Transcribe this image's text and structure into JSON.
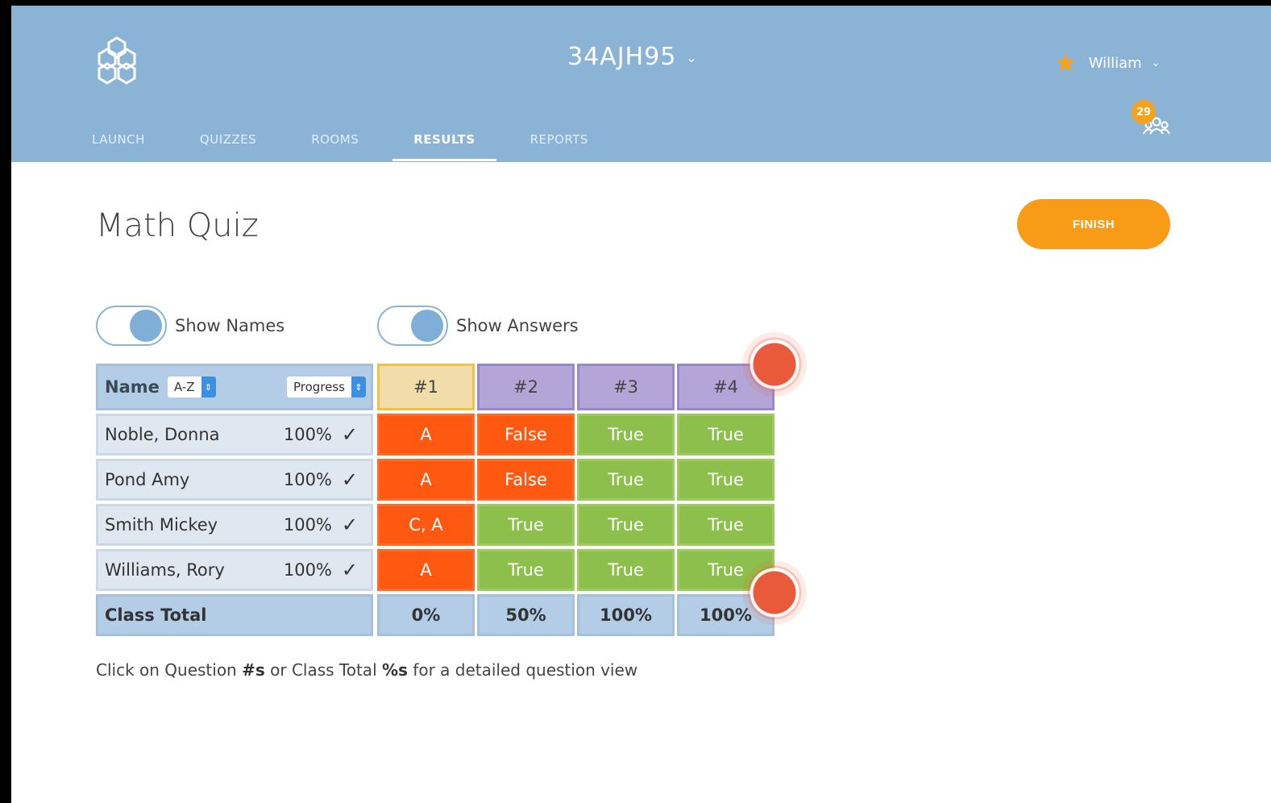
{
  "header": {
    "room_code": "34AJH95",
    "user_name": "William",
    "student_count": "29",
    "tabs": [
      {
        "label": "LAUNCH",
        "active": false
      },
      {
        "label": "QUIZZES",
        "active": false
      },
      {
        "label": "ROOMS",
        "active": false
      },
      {
        "label": "RESULTS",
        "active": true
      },
      {
        "label": "REPORTS",
        "active": false
      }
    ]
  },
  "page": {
    "title": "Math Quiz",
    "finish_label": "FINISH",
    "toggles": {
      "show_names": "Show Names",
      "show_answers": "Show Answers"
    }
  },
  "table": {
    "name_header": "Name",
    "sort_value": "A-Z",
    "progress_value": "Progress",
    "questions": [
      "#1",
      "#2",
      "#3",
      "#4"
    ],
    "rows": [
      {
        "name": "Noble, Donna",
        "progress": "100%",
        "answers": [
          {
            "text": "A",
            "correct": false
          },
          {
            "text": "False",
            "correct": false
          },
          {
            "text": "True",
            "correct": true
          },
          {
            "text": "True",
            "correct": true
          }
        ]
      },
      {
        "name": "Pond Amy",
        "progress": "100%",
        "answers": [
          {
            "text": "A",
            "correct": false
          },
          {
            "text": "False",
            "correct": false
          },
          {
            "text": "True",
            "correct": true
          },
          {
            "text": "True",
            "correct": true
          }
        ]
      },
      {
        "name": "Smith Mickey",
        "progress": "100%",
        "answers": [
          {
            "text": "C, A",
            "correct": false
          },
          {
            "text": "True",
            "correct": true
          },
          {
            "text": "True",
            "correct": true
          },
          {
            "text": "True",
            "correct": true
          }
        ]
      },
      {
        "name": "Williams, Rory",
        "progress": "100%",
        "answers": [
          {
            "text": "A",
            "correct": false
          },
          {
            "text": "True",
            "correct": true
          },
          {
            "text": "True",
            "correct": true
          },
          {
            "text": "True",
            "correct": true
          }
        ]
      }
    ],
    "class_total_label": "Class Total",
    "totals": [
      "0%",
      "50%",
      "100%",
      "100%"
    ]
  },
  "hint": {
    "before": "Click on Question ",
    "bold1": "#s",
    "middle": " or Class Total ",
    "bold2": "%s",
    "after": " for a detailed question view"
  },
  "colors": {
    "header_bg": "#8ab3d5",
    "accent_orange": "#f89b16",
    "incorrect": "#ff5811",
    "correct": "#8cbf4c",
    "q1_header": "#f2dcaa",
    "q_header": "#b3a6d6"
  }
}
